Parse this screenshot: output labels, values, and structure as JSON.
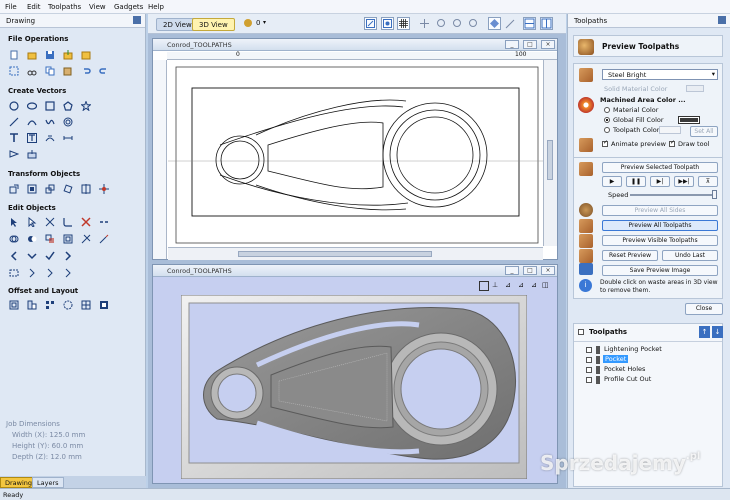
{
  "menu": [
    "File",
    "Edit",
    "Toolpaths",
    "View",
    "Gadgets",
    "Help"
  ],
  "left_panel": {
    "title": "Drawing",
    "sections": {
      "file_operations": "File Operations",
      "create_vectors": "Create Vectors",
      "transform_objects": "Transform Objects",
      "edit_objects": "Edit Objects",
      "offset_layout": "Offset and Layout"
    },
    "job_dimensions": {
      "title": "Job Dimensions",
      "width": "Width  (X): 125.0 mm",
      "height": "Height (Y): 60.0 mm",
      "depth": "Depth  (Z): 12.0 mm"
    },
    "tabs": [
      "Drawing",
      "Layers"
    ]
  },
  "toolbar": {
    "tab_2d": "2D View",
    "tab_3d": "3D View",
    "layer_value": "0"
  },
  "windows": {
    "view2d_title": "Conrod_TOOLPATHS",
    "view3d_title": "Conrod_TOOLPATHS",
    "ruler_0": "0",
    "ruler_100": "100"
  },
  "right_panel": {
    "title": "Toolpaths",
    "header": "Preview Toolpaths",
    "material_select": "Steel Bright",
    "solid_material_color": "Solid Material Color",
    "machined_area_color": "Machined Area Color ...",
    "material_color": "Material Color",
    "global_fill_color": "Global Fill Color",
    "toolpath_color": "Toolpath Color",
    "set_all": "Set All",
    "animate_preview": "Animate preview",
    "draw_tool": "Draw tool",
    "preview_selected": "Preview Selected Toolpath",
    "speed": "Speed",
    "preview_all_sides": "Preview All Sides",
    "preview_all_toolpaths": "Preview All Toolpaths",
    "preview_visible": "Preview Visible Toolpaths",
    "reset_preview": "Reset Preview",
    "undo_last": "Undo Last",
    "save_preview_image": "Save Preview Image",
    "hint": "Double click on waste areas in 3D view to remove them.",
    "close": "Close",
    "toolpaths_header": "Toolpaths",
    "toolpath_items": [
      "Lightening Pocket",
      "Pocket",
      "Pocket Holes",
      "Profile Cut Out"
    ]
  },
  "status": "Ready",
  "watermark": {
    "main": "Sprzedajemy",
    "suffix": ".pl"
  },
  "colors": {
    "accent": "#3a78d6",
    "selected": "#3399ff",
    "panel": "#dfe8f4"
  }
}
